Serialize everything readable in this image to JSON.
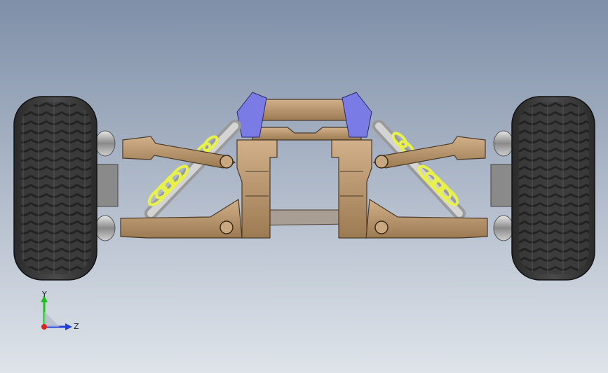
{
  "viewport": {
    "background_top": "#7f8fa8",
    "background_bottom": "#dfe4ea"
  },
  "colors": {
    "tire": "#3c3c3c",
    "tire_tread": "#262626",
    "arm": "#b8946a",
    "arm_edge": "#4a3a28",
    "spring": "#e8f04a",
    "shock_body": "#c9c9c9",
    "mount": "#7a7ae0",
    "plate": "#9a9088",
    "axis_x": "#e02020",
    "axis_y": "#20c020",
    "axis_z": "#2040e0"
  },
  "model": {
    "parts": [
      "left-tire",
      "right-tire",
      "upper-left-arm",
      "upper-right-arm",
      "lower-left-arm",
      "lower-right-arm",
      "left-shock",
      "right-shock",
      "center-bulkhead",
      "top-brace",
      "left-shock-mount",
      "right-shock-mount",
      "bottom-plate"
    ]
  },
  "triad": {
    "y_label": "Y",
    "z_label": "Z"
  }
}
